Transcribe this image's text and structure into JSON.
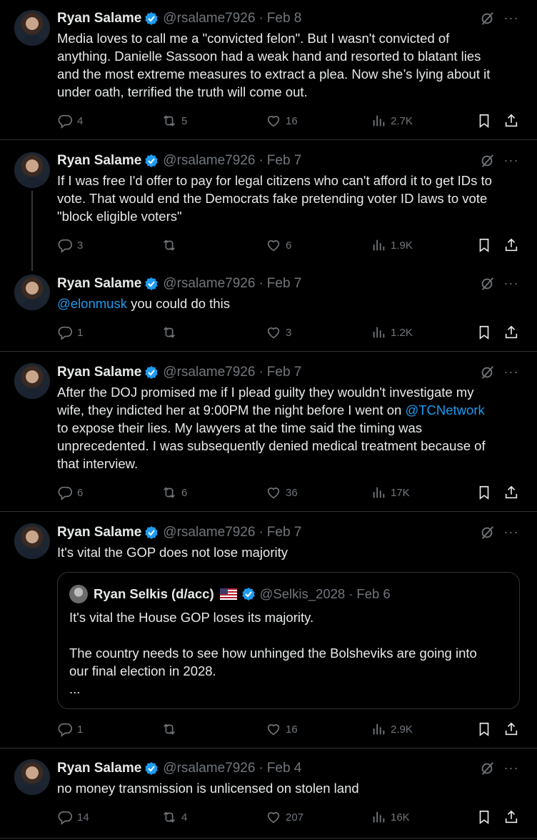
{
  "icons": {
    "reply": "reply-icon",
    "retweet": "retweet-icon",
    "like": "heart-icon",
    "views": "views-icon",
    "bookmark": "bookmark-icon",
    "share": "share-icon",
    "grok": "grok-icon",
    "more": "more-icon",
    "verified": "verified-icon"
  },
  "colors": {
    "background": "#000000",
    "text": "#e7e9ea",
    "muted": "#71767b",
    "link": "#1d9bf0",
    "border": "#2f3336"
  },
  "more_label": "···",
  "tweets": [
    {
      "name": "Ryan Salame",
      "handle": "@rsalame7926",
      "sep": "·",
      "date": "Feb 8",
      "text_lines": [
        "Media loves to call me a \"convicted felon\". But I wasn't convicted of",
        "anything. Danielle Sassoon had a weak hand and resorted to blatant lies",
        "and the most extreme measures to extract a plea. Now she’s lying about it",
        "under oath, terrified the truth will come out."
      ],
      "replies": "4",
      "retweets": "5",
      "likes": "16",
      "views": "2.7K"
    },
    {
      "name": "Ryan Salame",
      "handle": "@rsalame7926",
      "sep": "·",
      "date": "Feb 7",
      "text_lines": [
        "If I was free I'd offer to pay for legal citizens who can't afford it to get IDs to",
        "vote. That would end the Democrats fake pretending voter ID laws to vote",
        "\"block eligible voters\""
      ],
      "replies": "3",
      "retweets": "",
      "likes": "6",
      "views": "1.9K"
    },
    {
      "name": "Ryan Salame",
      "handle": "@rsalame7926",
      "sep": "·",
      "date": "Feb 7",
      "mention": "@elonmusk",
      "text_after": " you could do this",
      "replies": "1",
      "retweets": "",
      "likes": "3",
      "views": "1.2K"
    },
    {
      "name": "Ryan Salame",
      "handle": "@rsalame7926",
      "sep": "·",
      "date": "Feb 7",
      "line1": "After the DOJ promised me if I plead guilty they wouldn't investigate my",
      "line2a": "wife, they indicted her at 9:00PM the night before I went on ",
      "line2_mention": "@TCNetwork",
      "line3": "to expose their lies. My lawyers at the time said the timing was",
      "line4": "unprecedented. I was subsequently denied medical treatment because of",
      "line5": "that interview.",
      "replies": "6",
      "retweets": "6",
      "likes": "36",
      "views": "17K"
    },
    {
      "name": "Ryan Salame",
      "handle": "@rsalame7926",
      "sep": "·",
      "date": "Feb 7",
      "text": "It's vital the GOP does not lose majority",
      "quote": {
        "name": "Ryan Selkis (d/acc)",
        "handle": "@Selkis_2028",
        "sep": "·",
        "date": "Feb 6",
        "line1": "It's vital the House GOP loses its majority.",
        "line2": "The country needs to see how unhinged the Bolsheviks are going into",
        "line3": "our final election in 2028.",
        "line4": "..."
      },
      "replies": "1",
      "retweets": "",
      "likes": "16",
      "views": "2.9K"
    },
    {
      "name": "Ryan Salame",
      "handle": "@rsalame7926",
      "sep": "·",
      "date": "Feb 4",
      "text": "no money transmission is unlicensed on stolen land",
      "replies": "14",
      "retweets": "4",
      "likes": "207",
      "views": "16K"
    }
  ]
}
